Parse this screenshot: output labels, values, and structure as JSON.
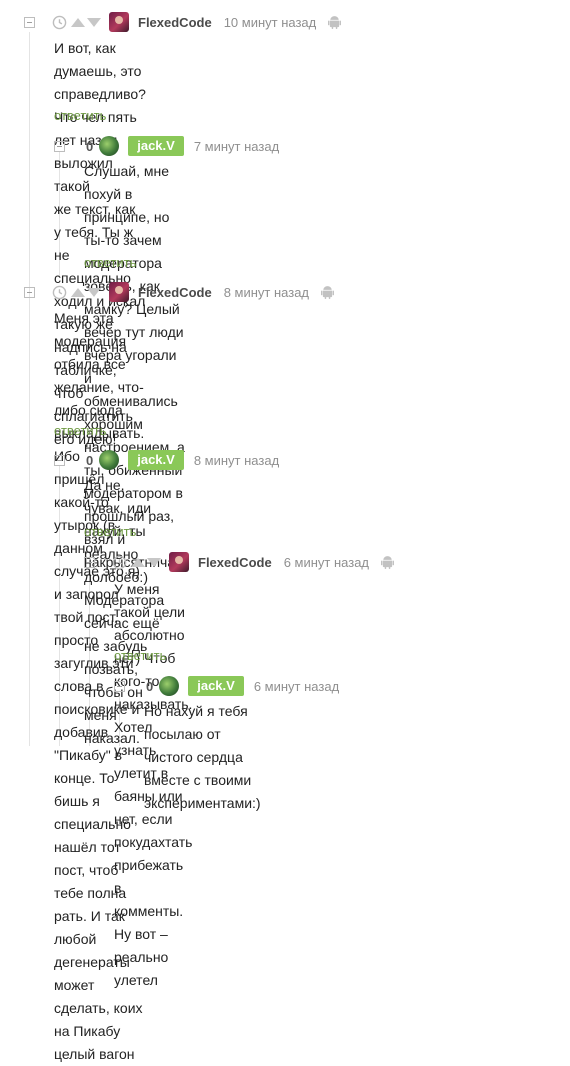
{
  "comments": [
    {
      "rating": "",
      "author": "FlexedCode",
      "time": "10 минут назад",
      "text": "И вот, как думаешь, это справедливо? Что чел пять лет назад выложил такой\nже текст, как у тебя. Ты ж не специально ходил и искал такую же надпись на\nтабличке, чтоб сплагиатить его идею!",
      "reply": "ответить"
    },
    {
      "rating": "0",
      "author": "jack.V",
      "time": "7 минут назад",
      "text": "Слушай, мне похуй в принципе, но ты-то зачем модератора зовёшь, как\nмамку? Целый вечер тут люди вчера угорали и обменивались хорошим\nнастроением, а ты, обиженный модератором в прошлый раз, взял и\nнакрысятничал.",
      "reply": "ответить"
    },
    {
      "rating": "",
      "author": "FlexedCode",
      "time": "8 минут назад",
      "text": "Меня эта модерация отбила все желание, что-либо сюда выкладывать. Ибо\nпришёл какой-то утырок (в данном случае это я) и запорол твой пост, просто\nзагуглив эти слова в поисковике и добавив \"Пикабу\" в конце. То бишь я\nспециально нашёл тот пост, чтоб тебе полна рать. И так любой дегенераты\nможет сделать, коих на Пикабу целый вагон",
      "reply": "ответить"
    },
    {
      "rating": "0",
      "author": "jack.V",
      "time": "8 минут назад",
      "text": "Да не, чувак, иди нахуй, ты реально долбоёб:)\nМодератора сейчас ещё не забудь позвать, чтобы он меня наказал.",
      "reply": "ответить"
    },
    {
      "rating": "",
      "author": "FlexedCode",
      "time": "6 минут назад",
      "text": "У меня такой цели абсолютно нет) Чтоб кого-то наказывать. Хотел\nузнать улетит в баяны или нет, если покудахтать прибежать в\nкомменты. Ну вот – реально улетел",
      "reply": "ответить"
    },
    {
      "rating": "0",
      "author": "jack.V",
      "time": "6 минут назад",
      "text": "Но нахуй я тебя посылаю от чистого сердца вместе с твоими\nэкспериментами:)",
      "reply": ""
    }
  ],
  "icons": {
    "collapse": "minus-square-icon",
    "clock": "clock-icon",
    "upvote": "arrow-up-icon",
    "downvote": "arrow-down-icon",
    "platform": "android-icon"
  },
  "colors": {
    "reply_link": "#6f9a44",
    "badge": "#8ac858",
    "muted": "#8f8f8f"
  }
}
